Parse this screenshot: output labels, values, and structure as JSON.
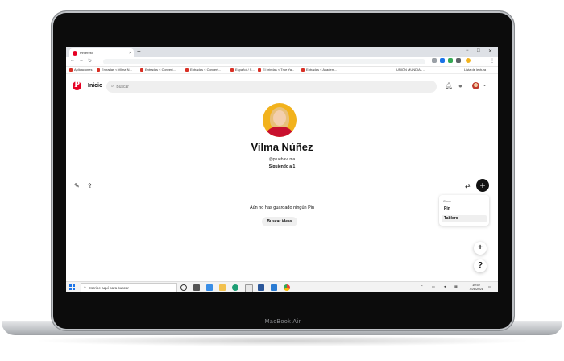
{
  "device": {
    "model": "MacBook Air"
  },
  "browser": {
    "tab_title": "Pinterest",
    "tab_close": "×",
    "new_tab": "+",
    "window_controls": {
      "minimize": "−",
      "maximize": "□",
      "close": "✕"
    },
    "bookmarks": [
      "Aplicaciones",
      "Entradas < Vilma N...",
      "Entradas < Convert...",
      "Entradas < Convert...",
      "Español / S...",
      "El brindas < True Ya...",
      "Entradas < Academ...",
      "UNIÓN MUNDIAL ...",
      "Lista de lectura"
    ]
  },
  "pinterest": {
    "logo": "P",
    "home_label": "Inicio",
    "search_placeholder": "Buscar",
    "profile": {
      "name": "Vilma Núñez",
      "handle": "@pruebavi ma",
      "following": "Siguiendo a 1"
    },
    "empty_state": "Aún no has guardado ningún Pin",
    "find_ideas_label": "Buscar ideas",
    "create_menu": {
      "title": "Crear",
      "items": [
        "Pin",
        "Tablero"
      ]
    },
    "plus_glyph": "+",
    "floating": {
      "add": "+",
      "help": "?"
    }
  },
  "taskbar": {
    "search_placeholder": "Escribe aquí para buscar",
    "time": "10:52",
    "date": "7/26/2021"
  },
  "colors": {
    "pinterest_red": "#e60023",
    "avatar_bg": "#f2b21c"
  }
}
